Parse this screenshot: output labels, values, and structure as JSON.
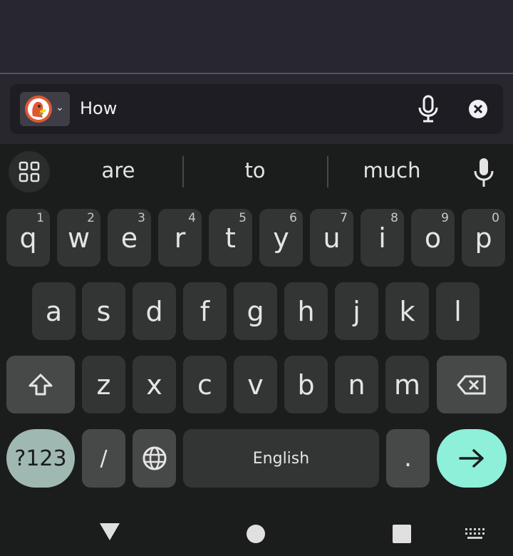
{
  "search": {
    "query": "How",
    "engine_icon": "duckduckgo-logo",
    "mic_icon": "mic-icon",
    "clear_icon": "clear-icon"
  },
  "suggestions": [
    "are",
    "to",
    "much"
  ],
  "keyboard": {
    "row1": [
      {
        "key": "q",
        "hint": "1"
      },
      {
        "key": "w",
        "hint": "2"
      },
      {
        "key": "e",
        "hint": "3"
      },
      {
        "key": "r",
        "hint": "4"
      },
      {
        "key": "t",
        "hint": "5"
      },
      {
        "key": "y",
        "hint": "6"
      },
      {
        "key": "u",
        "hint": "7"
      },
      {
        "key": "i",
        "hint": "8"
      },
      {
        "key": "o",
        "hint": "9"
      },
      {
        "key": "p",
        "hint": "0"
      }
    ],
    "row2": [
      "a",
      "s",
      "d",
      "f",
      "g",
      "h",
      "j",
      "k",
      "l"
    ],
    "row3": [
      "z",
      "x",
      "c",
      "v",
      "b",
      "n",
      "m"
    ],
    "symbols_label": "?123",
    "slash_label": "/",
    "space_label": "English",
    "period_label": ".",
    "colors": {
      "accent": "#8ef0d9",
      "symbols": "#9fb8b2",
      "key": "#333535",
      "modifier": "#474948"
    }
  },
  "navbar": {
    "icons": [
      "back-icon",
      "home-icon",
      "recents-icon",
      "keyboard-switch-icon"
    ]
  }
}
